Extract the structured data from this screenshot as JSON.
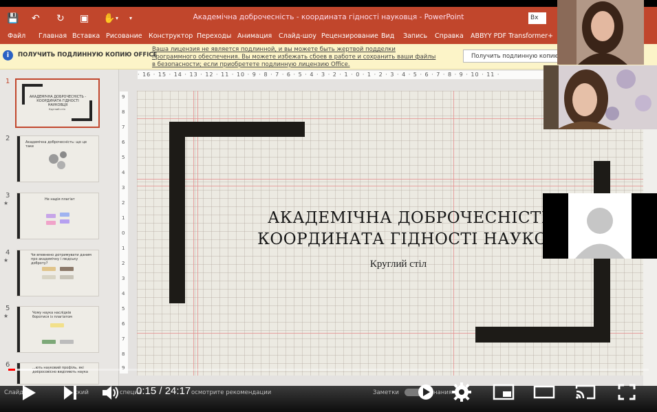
{
  "window": {
    "title": "Академічна доброчесність - координата гідності науковця - PowerPoint",
    "login_label": "Вх"
  },
  "ribbon": {
    "tabs": [
      "Файл",
      "Главная",
      "Вставка",
      "Рисование",
      "Конструктор",
      "Переходы",
      "Анимация",
      "Слайд-шоу",
      "Рецензирование",
      "Вид",
      "Запись",
      "Справка",
      "ABBYY PDF Transformer+"
    ]
  },
  "warning": {
    "icon": "i",
    "title": "ПОЛУЧИТЬ ПОДЛИННУЮ КОПИЮ OFFICE",
    "text": "Ваша лицензия не является подлинной, и вы можете быть жертвой подделки программного обеспечения. Вы можете избежать сбоев в работе и сохранить ваши файлы в безопасности; если приобретете подлинную лицензию Office.",
    "button_label": "Получить подлинную копию"
  },
  "thumbnails": [
    {
      "num": "1",
      "text": "АКАДЕМІЧНА ДОБРОЧЕСНІСТЬ - КООРДИНАТА ГІДНОСТІ НАУКОВЦЯ",
      "sub": "Круглий стіл"
    },
    {
      "num": "2",
      "text": "Академічна доброчесність: що це таке"
    },
    {
      "num": "3",
      "text": "Не надія плагіат"
    },
    {
      "num": "4",
      "text": "Чи впевнено дотримувати даним про академічну і людську доброту?"
    },
    {
      "num": "5",
      "text": "Чому наука наслідків боротися із плагіатом"
    },
    {
      "num": "6",
      "text": "...ють науковий профіль, які добросовісно виділяють наука"
    }
  ],
  "ruler": {
    "horizontal": "· 16 · 15 · 14 · 13 · 12 · 11 · 10 · 9 · 8 · 7 · 6 · 5 · 4 · 3 · 2 · 1 · 0 · 1 · 2 · 3 · 4 · 5 · 6 · 7 · 8 · 9 · 10 · 11 ·",
    "vertical": [
      "9",
      "8",
      "7",
      "6",
      "5",
      "4",
      "3",
      "2",
      "1",
      "0",
      "1",
      "2",
      "3",
      "4",
      "5",
      "6",
      "7",
      "8",
      "9"
    ]
  },
  "slide": {
    "title_line1": "АКАДЕМІЧНА ДОБРОЧЕСНІСТЬ -",
    "title_line2": "КООРДИНАТА ГІДНОСТІ НАУКОВЦ",
    "subtitle": "Круглий стіл",
    "bracket_color": "#1d1b17",
    "background": "#eceae2"
  },
  "status": {
    "slide_label": "Слайд",
    "lang": "ский",
    "specialities": "специа",
    "recommend": "осмотрите рекомендации",
    "notes": "Заметки",
    "annotations": "нания"
  },
  "player": {
    "time_current": "0:15",
    "time_separator": " / ",
    "time_total": "24:17",
    "progress_fraction": 0.0103,
    "accent": "#ff0000"
  }
}
